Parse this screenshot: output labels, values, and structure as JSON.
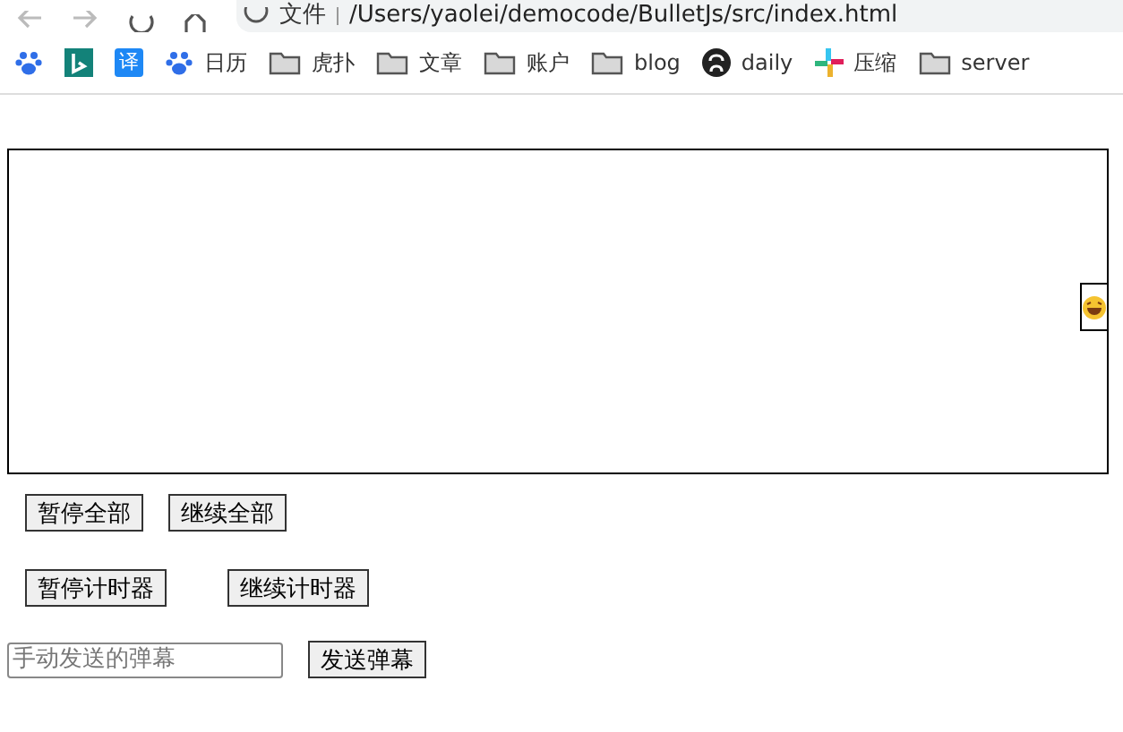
{
  "address_bar": {
    "scheme_label": "文件",
    "url": "/Users/yaolei/democode/BulletJs/src/index.html"
  },
  "bookmarks": [
    {
      "kind": "paw"
    },
    {
      "kind": "bing"
    },
    {
      "kind": "translate",
      "label": "译"
    },
    {
      "kind": "paw",
      "label": "日历"
    },
    {
      "kind": "folder",
      "label": "虎扑"
    },
    {
      "kind": "folder",
      "label": "文章"
    },
    {
      "kind": "folder",
      "label": "账户"
    },
    {
      "kind": "folder",
      "label": "blog"
    },
    {
      "kind": "github",
      "label": "daily"
    },
    {
      "kind": "slack",
      "label": "压缩"
    },
    {
      "kind": "folder",
      "label": "server"
    }
  ],
  "button_rows": [
    [
      "暂停全部",
      "继续全部"
    ],
    [
      "暂停计时器",
      "继续计时器"
    ]
  ],
  "danmaku_input": {
    "placeholder": "手动发送的弹幕"
  },
  "send_button": "发送弹幕"
}
